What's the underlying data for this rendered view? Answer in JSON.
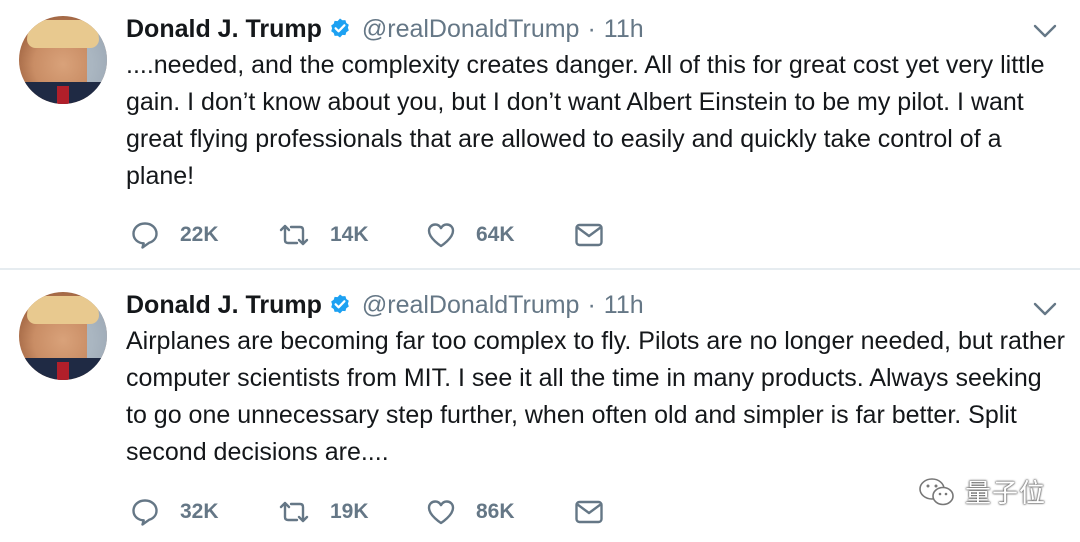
{
  "colors": {
    "text": "#14171a",
    "secondary": "#657786",
    "verified": "#1da1f2",
    "divider": "#e6ecf0"
  },
  "tweets": [
    {
      "name": "Donald J. Trump",
      "handle": "@realDonaldTrump",
      "separator": "·",
      "time": "11h",
      "text": "....needed, and the complexity creates danger. All of this for great cost yet very little gain. I don’t know about you, but I don’t want Albert Einstein to be my pilot. I want great flying professionals that are allowed to easily and quickly take control of a plane!",
      "replies": "22K",
      "retweets": "14K",
      "likes": "64K",
      "icons": {
        "verified": "verified-badge-icon",
        "menu": "chevron-down-icon",
        "reply": "reply-icon",
        "retweet": "retweet-icon",
        "like": "heart-icon",
        "dm": "envelope-icon"
      }
    },
    {
      "name": "Donald J. Trump",
      "handle": "@realDonaldTrump",
      "separator": "·",
      "time": "11h",
      "text": "Airplanes are becoming far too complex to fly. Pilots are no longer needed, but rather computer scientists from MIT. I see it all the time in many products. Always seeking to go one unnecessary step further, when often old and simpler is far better. Split second decisions are....",
      "replies": "32K",
      "retweets": "19K",
      "likes": "86K",
      "icons": {
        "verified": "verified-badge-icon",
        "menu": "chevron-down-icon",
        "reply": "reply-icon",
        "retweet": "retweet-icon",
        "like": "heart-icon",
        "dm": "envelope-icon"
      }
    }
  ],
  "watermark": {
    "text": "量子位",
    "icon": "wechat-icon"
  }
}
